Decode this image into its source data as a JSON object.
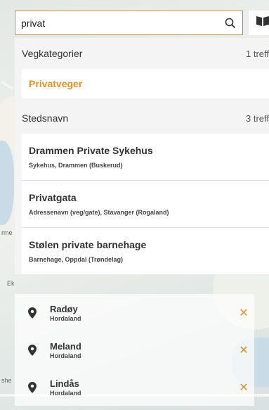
{
  "search": {
    "value": "privat",
    "placeholder": ""
  },
  "categories": [
    {
      "title": "Vegkategorier",
      "count": "1 treff",
      "items": [
        {
          "title": "Privatveger"
        }
      ]
    },
    {
      "title": "Stedsnavn",
      "count": "3 treff",
      "items": [
        {
          "title": "Drammen Private Sykehus",
          "subtitle": "Sykehus, Drammen (Buskerud)"
        },
        {
          "title": "Privatgata",
          "subtitle": "Adressenavn (veg/gate), Stavanger (Rogaland)"
        },
        {
          "title": "Stølen private barnehage",
          "subtitle": "Barnehage, Oppdal (Trøndelag)"
        }
      ]
    }
  ],
  "history": [
    {
      "name": "Radøy",
      "region": "Hordaland"
    },
    {
      "name": "Meland",
      "region": "Hordaland"
    },
    {
      "name": "Lindås",
      "region": "Hordaland"
    }
  ],
  "map_labels": {
    "left1": "rme",
    "left2": "Ek",
    "left3": "she"
  },
  "colors": {
    "accent": "#e8901e",
    "border": "#d08a2a"
  }
}
